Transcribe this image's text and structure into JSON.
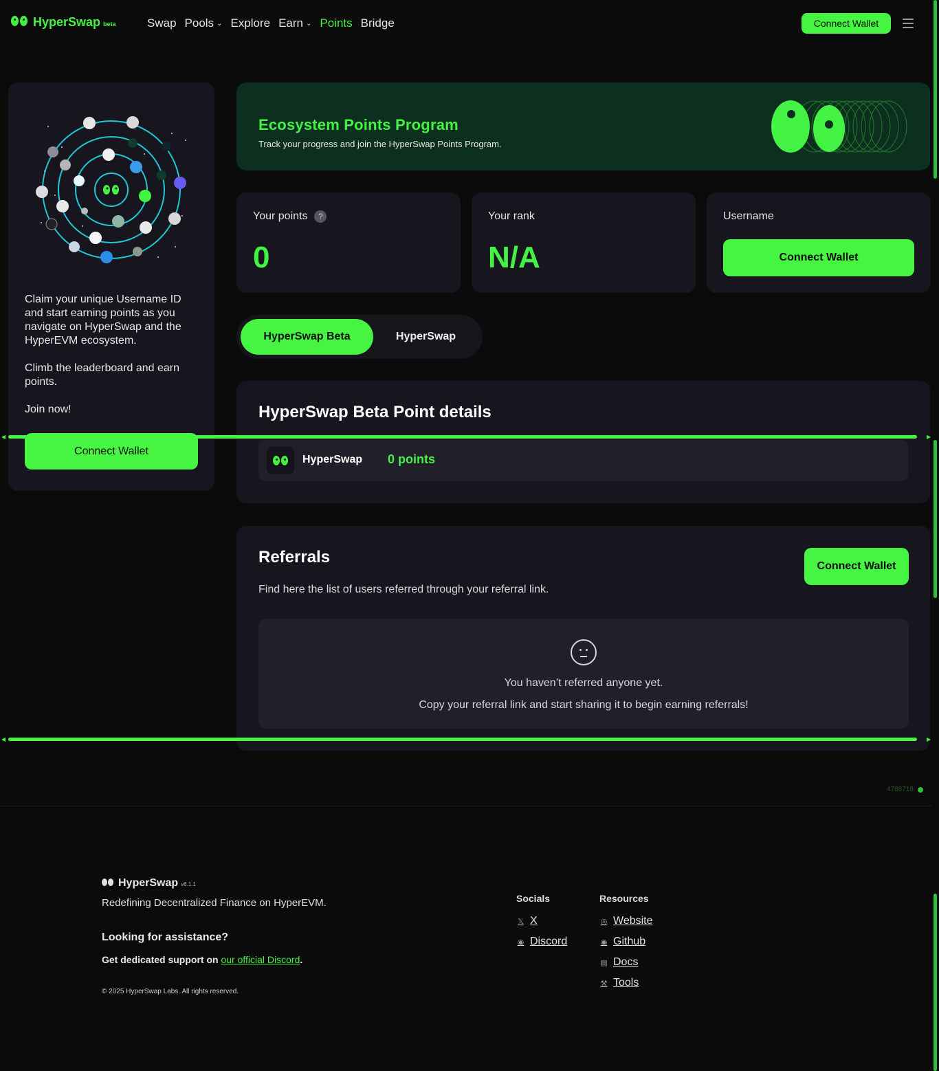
{
  "header": {
    "logo_text": "HyperSwap",
    "logo_badge": "beta",
    "nav": [
      {
        "label": "Swap",
        "dropdown": false,
        "active": false
      },
      {
        "label": "Pools",
        "dropdown": true,
        "active": false
      },
      {
        "label": "Explore",
        "dropdown": false,
        "active": false
      },
      {
        "label": "Earn",
        "dropdown": true,
        "active": false
      },
      {
        "label": "Points",
        "dropdown": false,
        "active": true
      },
      {
        "label": "Bridge",
        "dropdown": false,
        "active": false
      }
    ],
    "connect_label": "Connect Wallet",
    "menu_icon": "hamburger-icon"
  },
  "left_card": {
    "paragraphs": [
      "Claim your unique Username ID and start earning points as you navigate on HyperSwap and the HyperEVM ecosystem.",
      "Climb the leaderboard and earn points.",
      "Join now!"
    ],
    "connect_label": "Connect Wallet"
  },
  "banner": {
    "title": "Ecosystem Points Program",
    "subtitle": "Track your progress and join the HyperSwap Points Program."
  },
  "stats": {
    "points_label": "Your points",
    "points_help": "?",
    "points_value": "0",
    "rank_label": "Your rank",
    "rank_value": "N/A",
    "username_label": "Username",
    "username_connect": "Connect Wallet"
  },
  "tabs": [
    "HyperSwap Beta",
    "HyperSwap"
  ],
  "details": {
    "title": "HyperSwap Beta Point details",
    "row_name": "HyperSwap",
    "row_points": "0 points"
  },
  "referrals": {
    "title": "Referrals",
    "description": "Find here the list of users referred through your referral link.",
    "connect_label": "Connect Wallet",
    "empty_title": "You haven’t referred anyone yet.",
    "empty_subtitle": "Copy your referral link and start sharing it to begin earning referrals!"
  },
  "block_number": "4788718",
  "footer": {
    "logo_text": "HyperSwap",
    "version": "v6.1.1",
    "tagline": "Redefining Decentralized Finance on HyperEVM.",
    "help_title": "Looking for assistance?",
    "support_prefix": "Get dedicated support on ",
    "support_link": "our official Discord",
    "support_suffix": ".",
    "copyright": "© 2025 HyperSwap Labs. All rights reserved.",
    "socials_title": "Socials",
    "socials": [
      {
        "label": "X",
        "icon": "x-icon"
      },
      {
        "label": "Discord",
        "icon": "discord-icon"
      }
    ],
    "resources_title": "Resources",
    "resources": [
      {
        "label": "Website",
        "icon": "globe-icon"
      },
      {
        "label": "Github",
        "icon": "github-icon"
      },
      {
        "label": "Docs",
        "icon": "docs-icon"
      },
      {
        "label": "Tools",
        "icon": "tools-icon"
      }
    ]
  },
  "colors": {
    "accent": "#45f541",
    "background": "#0b0b0b",
    "card": "#17161e",
    "banner": "#0c2f1f"
  }
}
